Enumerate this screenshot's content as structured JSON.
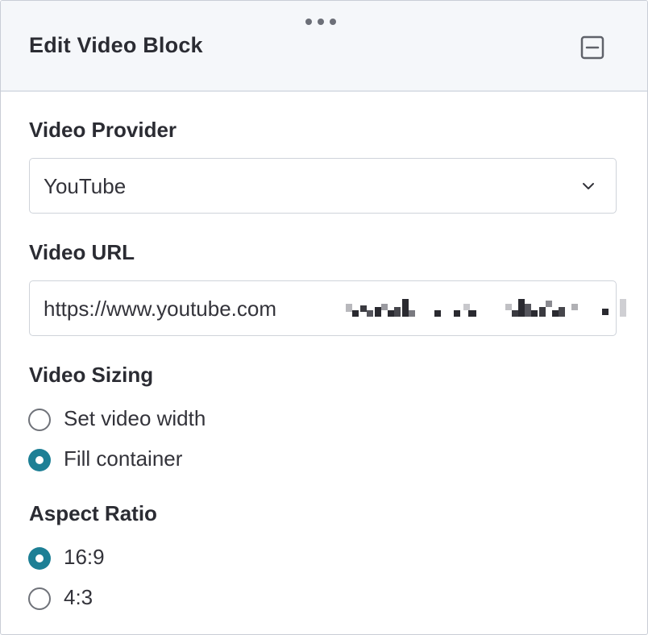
{
  "panel": {
    "title": "Edit Video Block",
    "drag_handle_icon": "drag-dots-icon",
    "collapse_icon": "collapse-minus-icon"
  },
  "video_provider": {
    "label": "Video Provider",
    "selected": "YouTube",
    "icon": "chevron-down-icon"
  },
  "video_url": {
    "label": "Video URL",
    "value": "https://www.youtube.com"
  },
  "video_sizing": {
    "label": "Video Sizing",
    "options": [
      {
        "label": "Set video width",
        "checked": false
      },
      {
        "label": "Fill container",
        "checked": true
      }
    ]
  },
  "aspect_ratio": {
    "label": "Aspect Ratio",
    "options": [
      {
        "label": "16:9",
        "checked": true
      },
      {
        "label": "4:3",
        "checked": false
      }
    ]
  },
  "colors": {
    "accent": "#1d7f95",
    "header_bg": "#f5f7fa",
    "border": "#cfd3da"
  }
}
